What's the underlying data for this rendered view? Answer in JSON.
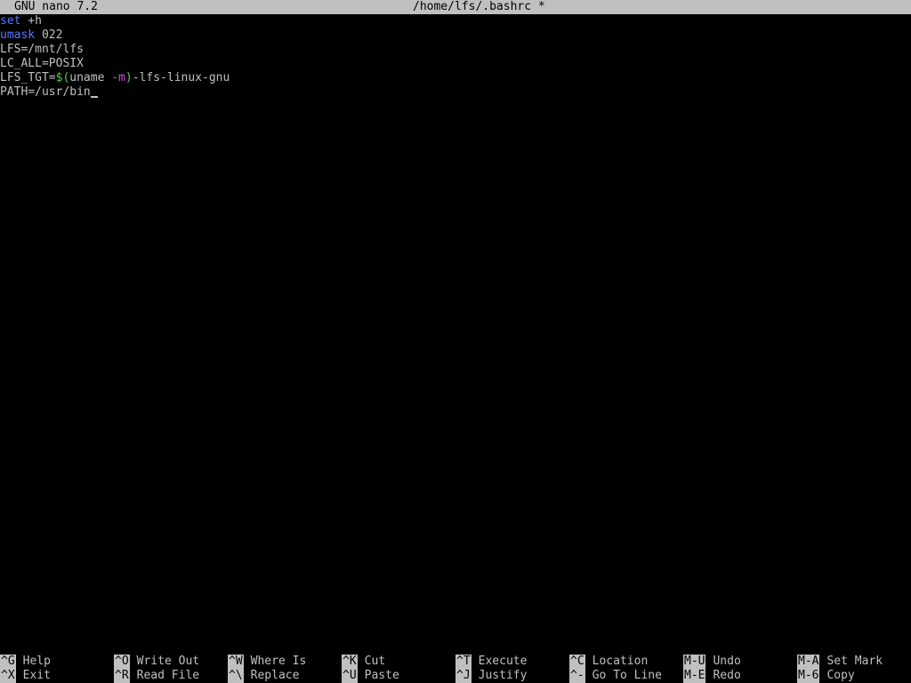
{
  "titlebar": {
    "app_name": "GNU nano 7.2",
    "file_path": "/home/lfs/.bashrc",
    "modified_marker": "*"
  },
  "editor": {
    "lines": [
      [
        {
          "text": "set",
          "color": "#5a78ff"
        },
        {
          "text": " +h",
          "color": "#c0c0c0"
        }
      ],
      [
        {
          "text": "umask",
          "color": "#5a78ff"
        },
        {
          "text": " 022",
          "color": "#c0c0c0"
        }
      ],
      [
        {
          "text": "LFS",
          "color": "#c0c0c0"
        },
        {
          "text": "=/mnt/lfs",
          "color": "#c0c0c0"
        }
      ],
      [
        {
          "text": "LC_ALL",
          "color": "#c0c0c0"
        },
        {
          "text": "=",
          "color": "#c0c0c0"
        },
        {
          "text": "POSIX",
          "color": "#c0c0c0"
        }
      ],
      [
        {
          "text": "LFS_TGT",
          "color": "#c0c0c0"
        },
        {
          "text": "=",
          "color": "#c0c0c0"
        },
        {
          "text": "$(",
          "color": "#4fd24f"
        },
        {
          "text": "uname ",
          "color": "#c0c0c0"
        },
        {
          "text": "-m",
          "color": "#d24fd2"
        },
        {
          "text": ")",
          "color": "#4fd24f"
        },
        {
          "text": "-lfs-linux-gnu",
          "color": "#c0c0c0"
        }
      ],
      [
        {
          "text": "PATH",
          "color": "#c0c0c0"
        },
        {
          "text": "=/usr/bin",
          "color": "#c0c0c0"
        }
      ]
    ]
  },
  "shortcuts": {
    "items": [
      {
        "key": "^G",
        "label": "Help"
      },
      {
        "key": "^X",
        "label": "Exit"
      },
      {
        "key": "^O",
        "label": "Write Out"
      },
      {
        "key": "^R",
        "label": "Read File"
      },
      {
        "key": "^W",
        "label": "Where Is"
      },
      {
        "key": "^\\",
        "label": "Replace"
      },
      {
        "key": "^K",
        "label": "Cut"
      },
      {
        "key": "^U",
        "label": "Paste"
      },
      {
        "key": "^T",
        "label": "Execute"
      },
      {
        "key": "^J",
        "label": "Justify"
      },
      {
        "key": "^C",
        "label": "Location"
      },
      {
        "key": "^-",
        "label": "Go To Line"
      },
      {
        "key": "M-U",
        "label": "Undo"
      },
      {
        "key": "M-E",
        "label": "Redo"
      },
      {
        "key": "M-A",
        "label": "Set Mark"
      },
      {
        "key": "M-6",
        "label": "Copy"
      }
    ]
  },
  "colors": {
    "background": "#000000",
    "foreground": "#c0c0c0",
    "title_bg": "#c0c0c0",
    "keyword": "#5a78ff",
    "subshell": "#4fd24f",
    "option": "#d24fd2"
  }
}
